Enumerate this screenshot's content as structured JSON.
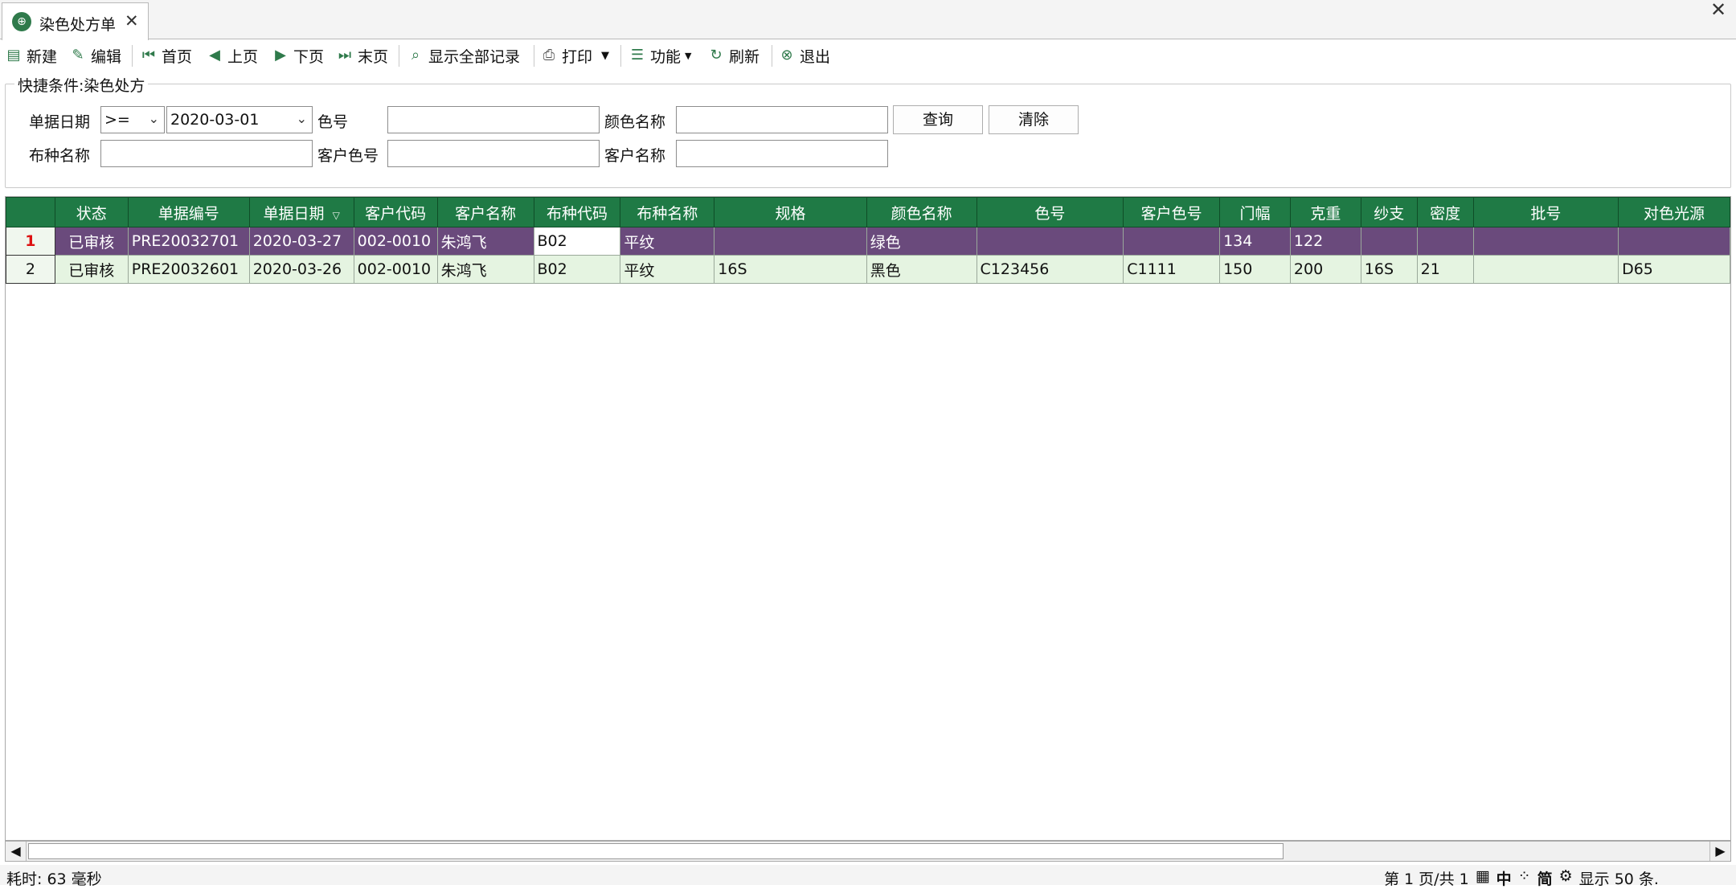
{
  "tab": {
    "title": "染色处方单",
    "close": "✕"
  },
  "window": {
    "close": "✕"
  },
  "toolbar": {
    "new": "新建",
    "edit": "编辑",
    "first": "首页",
    "prev": "上页",
    "next": "下页",
    "last": "末页",
    "show_all": "显示全部记录",
    "print": "打印",
    "functions": "功能",
    "refresh": "刷新",
    "exit": "退出"
  },
  "search": {
    "legend": "快捷条件:染色处方",
    "date_label": "单据日期",
    "date_op": ">=",
    "date_value": "2020-03-01",
    "color_no_label": "色号",
    "color_name_label": "颜色名称",
    "fabric_name_label": "布种名称",
    "customer_color_no_label": "客户色号",
    "customer_name_label": "客户名称",
    "query_btn": "查询",
    "clear_btn": "清除"
  },
  "grid": {
    "columns": [
      "",
      "状态",
      "单据编号",
      "单据日期",
      "客户代码",
      "客户名称",
      "布种代码",
      "布种名称",
      "规格",
      "颜色名称",
      "色号",
      "客户色号",
      "门幅",
      "克重",
      "纱支",
      "密度",
      "批号",
      "对色光源"
    ],
    "sort_indicator": "▽",
    "rows": [
      {
        "rn": "1",
        "cells": [
          "已审核",
          "PRE20032701",
          "2020-03-27",
          "002-0010",
          "朱鸿飞",
          "B02",
          "平纹",
          "",
          "绿色",
          "",
          "",
          "134",
          "122",
          "",
          "",
          "",
          ""
        ]
      },
      {
        "rn": "2",
        "cells": [
          "已审核",
          "PRE20032601",
          "2020-03-26",
          "002-0010",
          "朱鸿飞",
          "B02",
          "平纹",
          "16S",
          "黑色",
          "C123456",
          "C1111",
          "150",
          "200",
          "16S",
          "21",
          "",
          "D65"
        ]
      }
    ]
  },
  "scroll": {
    "left": "◀",
    "right": "▶"
  },
  "status": {
    "elapsed": "耗时: 63 毫秒",
    "page": "第 1 页/共 1",
    "ime1": "中",
    "ime2": "简",
    "show_count": "显示 50 条."
  }
}
